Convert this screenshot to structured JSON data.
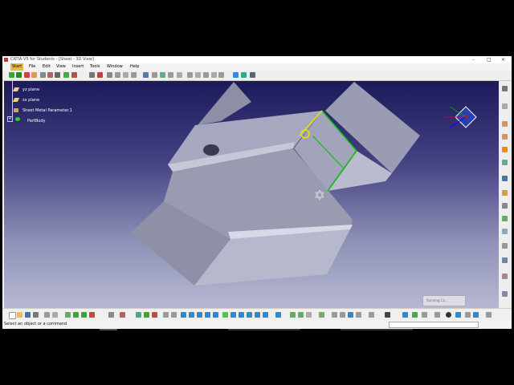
{
  "window": {
    "title": "CATIA V5 for Students - [Sheet - 3D View]"
  },
  "menu": {
    "items": [
      "Start",
      "File",
      "Edit",
      "View",
      "Insert",
      "Tools",
      "Window",
      "Help"
    ]
  },
  "tree": {
    "items": [
      {
        "label": "yz plane",
        "icon": "plane-icon"
      },
      {
        "label": "zx plane",
        "icon": "plane-icon"
      },
      {
        "label": "Sheet Metal Parameter.1",
        "icon": "sheet-metal-parameters-icon"
      },
      {
        "label": "PartBody",
        "icon": "partbody-gear-icon"
      }
    ]
  },
  "progress": {
    "label": "Running Co..."
  },
  "status": {
    "message": "Select an object or a command"
  },
  "colors": {
    "background_top": "#1c1a5b",
    "background_bottom": "#b7b9d3",
    "part": "#9a9cb3",
    "selection": "#00c000",
    "highlight": "#e8e000"
  }
}
